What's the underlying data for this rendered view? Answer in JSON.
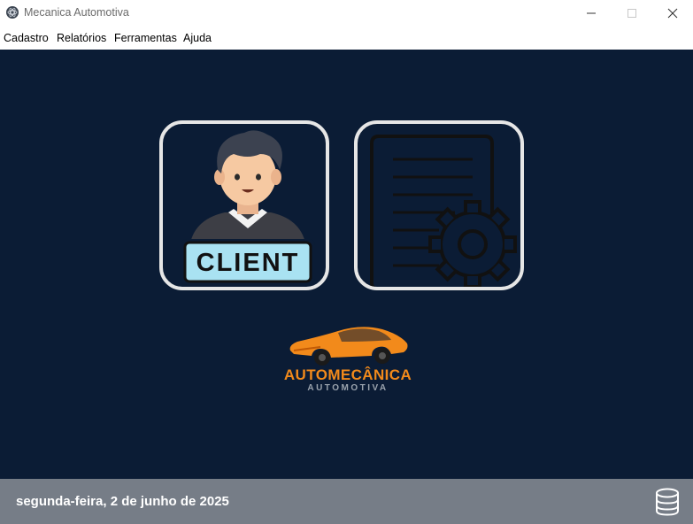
{
  "window": {
    "title": "Mecanica Automotiva"
  },
  "menu": {
    "items": [
      {
        "label": "Cadastro"
      },
      {
        "label": "Relatórios"
      },
      {
        "label": "Ferramentas"
      },
      {
        "label": "Ajuda"
      }
    ]
  },
  "tiles": {
    "clients": {
      "badge_text": "CLIENT",
      "icon": "client-icon"
    },
    "reports": {
      "icon": "report-settings-icon"
    }
  },
  "logo": {
    "main_text": "AUTOMECÂNICA",
    "sub_text": "AUTOMOTIVA",
    "icon": "sports-car-icon"
  },
  "status": {
    "date": "segunda-feira, 2 de junho de 2025",
    "icon": "database-icon"
  },
  "colors": {
    "background": "#0b1c35",
    "statusbar": "#767d87",
    "accent": "#f28a1b",
    "tile_border": "#e6e6e6"
  }
}
